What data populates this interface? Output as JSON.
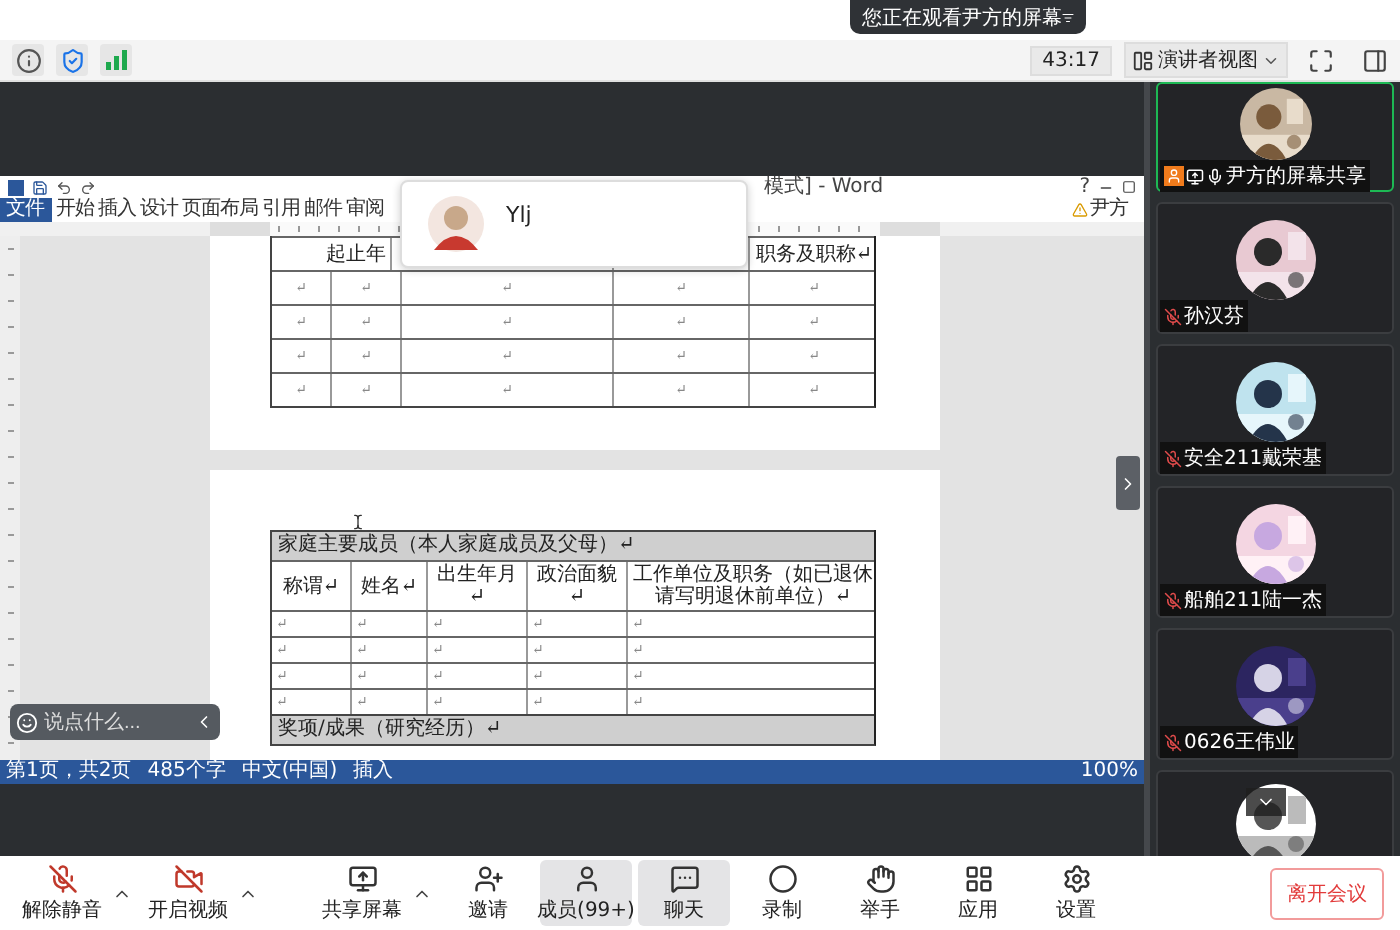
{
  "notice": {
    "text": "您正在观看尹方的屏幕"
  },
  "toolbar": {
    "timer": "43:17",
    "view_mode": "演讲者视图"
  },
  "shared_screen": {
    "word": {
      "title": "模式] - Word",
      "file_tab": "文件",
      "tabs": [
        "开始",
        "插入",
        "设计",
        "页面布局",
        "引用",
        "邮件",
        "审阅"
      ],
      "help": "?",
      "user": "尹方",
      "table_1": {
        "header_start": "起止年",
        "header_end": "职务及职称↵",
        "rows": [
          [
            "↵",
            "↵",
            "↵",
            "↵",
            "↵"
          ],
          [
            "↵",
            "↵",
            "↵",
            "↵",
            "↵"
          ],
          [
            "↵",
            "↵",
            "↵",
            "↵",
            "↵"
          ],
          [
            "↵",
            "↵",
            "↵",
            "↵",
            "↵"
          ]
        ]
      },
      "table_2": {
        "title": "家庭主要成员（本人家庭成员及父母）↵",
        "columns": [
          "称谓↵",
          "姓名↵",
          "出生年月↵",
          "政治面貌↵",
          "工作单位及职务（如已退休请写明退休前单位）↵"
        ],
        "rows": [
          [
            "↵",
            "↵",
            "↵",
            "↵",
            "↵"
          ],
          [
            "↵",
            "↵",
            "↵",
            "↵",
            "↵"
          ],
          [
            "↵",
            "↵",
            "↵",
            "↵",
            "↵"
          ],
          [
            "↵",
            "↵",
            "↵",
            "↵",
            "↵"
          ]
        ],
        "footer": "奖项/成果（研究经历）↵"
      },
      "status_bar": {
        "items": [
          "第1页，共2页",
          "485个字",
          "中文(中国)",
          "插入"
        ],
        "zoom": "100%"
      }
    },
    "popup": {
      "name": "Ylj"
    },
    "chat": {
      "placeholder": "说点什么..."
    }
  },
  "participants": [
    {
      "kind": "tile",
      "name": "尹方的屏幕共享",
      "host": true,
      "sharing": true,
      "muted": false,
      "selected": true
    },
    {
      "kind": "tile",
      "name": "孙汉芬",
      "host": false,
      "sharing": false,
      "muted": true,
      "selected": false
    },
    {
      "kind": "tile",
      "name": "安全211戴荣基",
      "host": false,
      "sharing": false,
      "muted": true,
      "selected": false
    },
    {
      "kind": "tile",
      "name": "船舶211陆一杰",
      "host": false,
      "sharing": false,
      "muted": true,
      "selected": false
    },
    {
      "kind": "tile",
      "name": "0626王伟业",
      "host": false,
      "sharing": false,
      "muted": true,
      "selected": false
    },
    {
      "kind": "partial"
    }
  ],
  "bottom_bar": {
    "items": [
      {
        "label": "解除静音",
        "caret": true,
        "selected": false
      },
      {
        "label": "开启视频",
        "caret": true,
        "selected": false
      },
      {
        "label": "共享屏幕",
        "caret": true,
        "selected": false
      },
      {
        "label": "邀请",
        "caret": false,
        "selected": false
      },
      {
        "label": "成员(99+)",
        "caret": false,
        "selected": true
      },
      {
        "label": "聊天",
        "caret": false,
        "selected": true
      },
      {
        "label": "录制",
        "caret": false,
        "selected": false
      },
      {
        "label": "举手",
        "caret": false,
        "selected": false
      },
      {
        "label": "应用",
        "caret": false,
        "selected": false
      },
      {
        "label": "设置",
        "caret": false,
        "selected": false
      }
    ],
    "leave": "离开会议"
  }
}
